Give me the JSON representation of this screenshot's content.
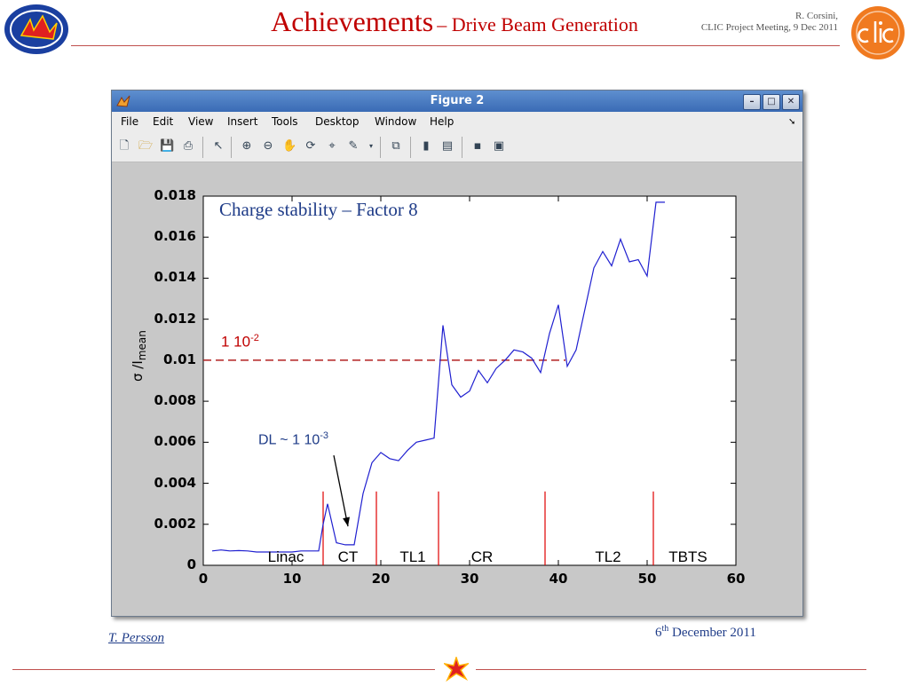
{
  "slide": {
    "title_main": "Achievements",
    "title_sub": "– Drive Beam Generation",
    "author_line1": "R. Corsini,",
    "author_line2": "CLIC Project Meeting, 9 Dec 2011",
    "footer_author": "T. Persson",
    "footer_date_num": "6",
    "footer_date_sup": "th",
    "footer_date_rest": " December 2011"
  },
  "window": {
    "title": "Figure 2",
    "buttons": {
      "minimize": "–",
      "maximize": "□",
      "close": "✕"
    },
    "menu": [
      "File",
      "Edit",
      "View",
      "Insert",
      "Tools",
      "Desktop",
      "Window",
      "Help"
    ],
    "toolbar_icons": [
      "new-figure-icon",
      "open-icon",
      "save-icon",
      "print-icon",
      "pointer-icon",
      "zoom-in-icon",
      "zoom-out-icon",
      "pan-icon",
      "rotate-icon",
      "data-cursor-icon",
      "brush-icon",
      "link-icon",
      "colorbar-icon",
      "legend-icon",
      "hide-tools-icon",
      "show-tools-icon"
    ]
  },
  "colors": {
    "accent_red": "#c00000",
    "line_blue": "#2020d0",
    "marker_red": "#e00000",
    "threshold": "#b22222",
    "annotation_blue": "#1f3c88"
  },
  "chart_data": {
    "type": "line",
    "title": "Charge stability – Factor 8",
    "xlabel": "",
    "ylabel": "σ /I",
    "ylabel_sub": "mean",
    "xlim": [
      0,
      60
    ],
    "ylim": [
      0,
      0.018
    ],
    "xticks": [
      "0",
      "10",
      "20",
      "30",
      "40",
      "50",
      "60"
    ],
    "yticks": [
      "0",
      "0.002",
      "0.004",
      "0.006",
      "0.008",
      "0.01",
      "0.012",
      "0.014",
      "0.016",
      "0.018"
    ],
    "x": [
      1,
      2,
      3,
      4,
      5,
      6,
      7,
      8,
      9,
      10,
      11,
      12,
      13,
      13.5,
      14,
      15,
      16,
      17,
      18,
      19,
      20,
      21,
      22,
      23,
      24,
      25,
      26,
      27,
      28,
      29,
      30,
      31,
      32,
      33,
      34,
      35,
      36,
      37,
      38,
      39,
      40,
      41,
      42,
      43,
      44,
      45,
      46,
      47,
      48,
      49,
      50,
      51,
      52
    ],
    "y": [
      0.0007,
      0.00075,
      0.0007,
      0.00072,
      0.0007,
      0.00065,
      0.00065,
      0.00065,
      0.00065,
      0.00065,
      0.0007,
      0.0007,
      0.0007,
      0.002,
      0.003,
      0.0011,
      0.001,
      0.001,
      0.0035,
      0.005,
      0.0055,
      0.0052,
      0.0051,
      0.0056,
      0.006,
      0.0061,
      0.0062,
      0.0117,
      0.0088,
      0.0082,
      0.0085,
      0.0095,
      0.0089,
      0.0096,
      0.01,
      0.0105,
      0.0104,
      0.0101,
      0.0094,
      0.0113,
      0.0127,
      0.0097,
      0.0105,
      0.0125,
      0.0145,
      0.0153,
      0.0146,
      0.0159,
      0.0148,
      0.0149,
      0.0141,
      0.0177,
      0.0177
    ],
    "threshold": {
      "y": 0.01,
      "label": "1 10",
      "label_exp": "-2"
    },
    "markers_x": [
      13.5,
      19.5,
      26.5,
      38.5,
      50.7
    ],
    "segments": [
      {
        "label": "Linac",
        "x": 9.3
      },
      {
        "label": "CT",
        "x": 16.3
      },
      {
        "label": "TL1",
        "x": 23.6
      },
      {
        "label": "CR",
        "x": 31.4
      },
      {
        "label": "TL2",
        "x": 45.6
      },
      {
        "label": "TBTS",
        "x": 54.6
      }
    ],
    "annotation": {
      "text": "DL ~ 1 10",
      "text_exp": "-3",
      "x": 16.3,
      "y": 0.0019
    }
  }
}
